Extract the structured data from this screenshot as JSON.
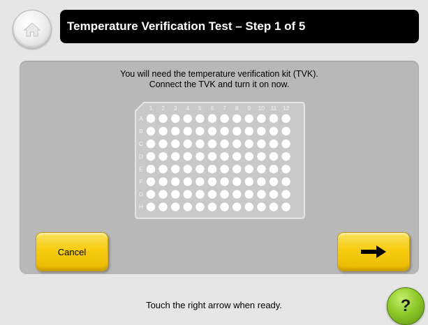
{
  "header": {
    "title": "Temperature Verification Test – Step 1 of 5",
    "home_icon": "home-icon"
  },
  "panel": {
    "instruction_line1": "You will need the temperature verification kit (TVK).",
    "instruction_line2": "Connect the TVK and turn it on now.",
    "plate": {
      "columns": [
        "1",
        "2",
        "3",
        "4",
        "5",
        "6",
        "7",
        "8",
        "9",
        "10",
        "11",
        "12"
      ],
      "rows": [
        "A",
        "B",
        "C",
        "D",
        "E",
        "F",
        "G",
        "H"
      ]
    }
  },
  "buttons": {
    "cancel_label": "Cancel",
    "next_icon": "right-arrow-icon"
  },
  "footer": {
    "message": "Touch the right arrow when ready."
  },
  "help": {
    "label": "?"
  },
  "colors": {
    "button_yellow": "#f7cd10",
    "title_bg": "#000000",
    "panel_bg": "#b8b8b8",
    "help_green": "#8fca2a"
  }
}
